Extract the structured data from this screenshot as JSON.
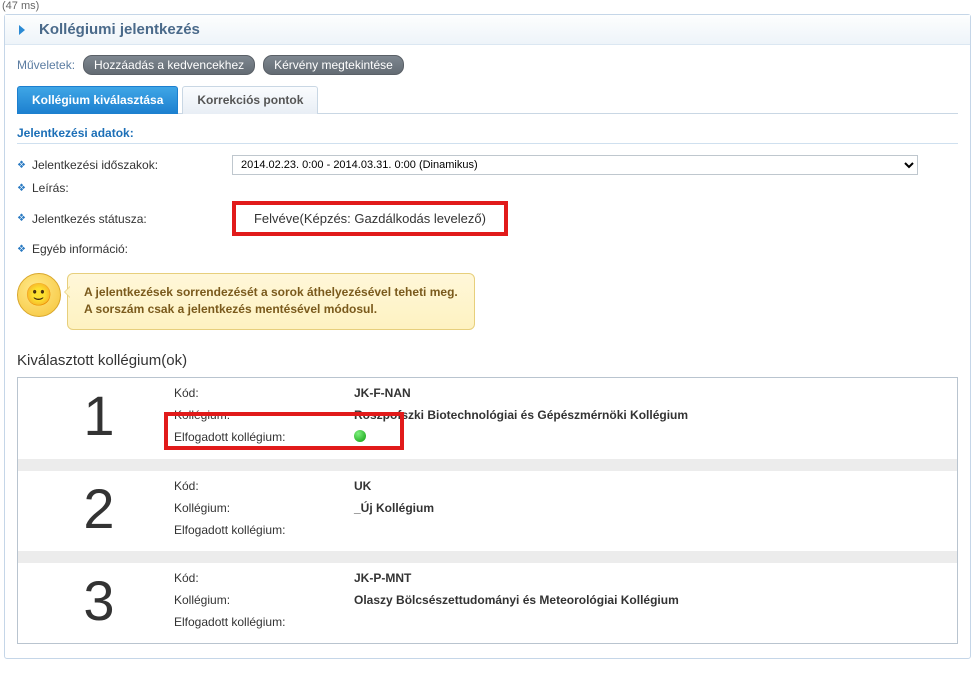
{
  "timing_text": "(47 ms)",
  "panel_title": "Kollégiumi jelentkezés",
  "actions": {
    "label": "Műveletek:",
    "add_favorite": "Hozzáadás a kedvencekhez",
    "view_request": "Kérvény megtekintése"
  },
  "tabs": {
    "select_dorm": "Kollégium kiválasztása",
    "correction_points": "Korrekciós pontok"
  },
  "section_title": "Jelentkezési adatok:",
  "meta": {
    "periods_label": "Jelentkezési időszakok:",
    "periods_value": "2014.02.23. 0:00 - 2014.03.31. 0:00 (Dinamikus)",
    "description_label": "Leírás:",
    "status_label": "Jelentkezés státusza:",
    "status_value": "Felvéve(Képzés: Gazdálkodás levelező)",
    "other_info_label": "Egyéb információ:"
  },
  "tip": {
    "line1": "A jelentkezések sorrendezését a sorok áthelyezésével teheti meg.",
    "line2": "A sorszám csak a jelentkezés mentésével módosul."
  },
  "selected_heading": "Kiválasztott kollégium(ok)",
  "labels": {
    "code": "Kód:",
    "dorm": "Kollégium:",
    "accepted": "Elfogadott kollégium:"
  },
  "choices": [
    {
      "num": "1",
      "code": "JK-F-NAN",
      "name": "Roszpofszki Biotechnológiai és Gépészmérnöki Kollégium",
      "accepted": true
    },
    {
      "num": "2",
      "code": "UK",
      "name": "_Új Kollégium",
      "accepted": false
    },
    {
      "num": "3",
      "code": "JK-P-MNT",
      "name": "Olaszy Bölcsészettudományi és Meteorológiai Kollégium",
      "accepted": false
    }
  ]
}
